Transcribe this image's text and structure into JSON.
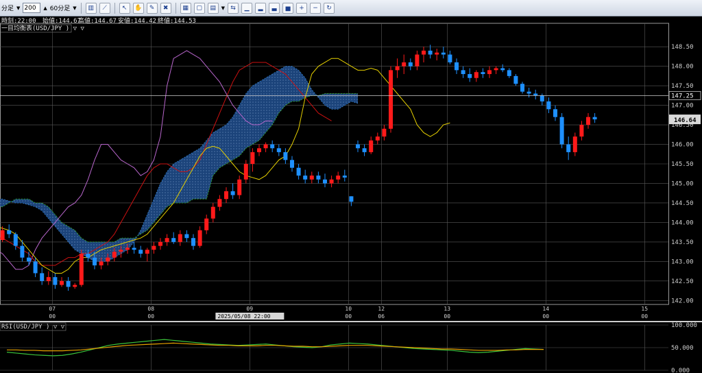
{
  "toolbar": {
    "period_label": "分足",
    "bar_count": "200",
    "timeframe": "60分足",
    "icons": [
      "bar-chart-icon",
      "line-chart-icon",
      "cursor-icon",
      "hand-icon",
      "pencil-icon",
      "trash-icon",
      "tile-icon",
      "window-icon",
      "indicator-icon",
      "compare-icon",
      "chart-a-icon",
      "chart-b-icon",
      "chart-c-icon",
      "chart-d-icon",
      "zoom-in-icon",
      "zoom-out-icon",
      "refresh-icon"
    ]
  },
  "info": {
    "time": "時刻:22:00",
    "open": "始値:144.67",
    "high": "高値:144.67",
    "low": "安値:144.42",
    "close": "終値:144.53"
  },
  "colors": {
    "up": "#ff1a1a",
    "down": "#1e90ff",
    "cloud": "#1e4a88",
    "tenkan": "#e6d000",
    "kijun": "#cc1111",
    "chikou": "#b866cc",
    "span_a": "#2a6fb6",
    "span_b": "#2e9e2e",
    "rsi": "#3bc43b",
    "rsi_ma": "#e8a300"
  },
  "main_panel": {
    "title": "一目均衡表(USD/JPY ) ▽ ▽"
  },
  "rsi_panel": {
    "title": "RSI(USD/JPY ) ▽ ▽"
  },
  "chart_data": [
    {
      "type": "candlestick",
      "title": "一目均衡表(USD/JPY )",
      "y_ticks": [
        142.0,
        142.5,
        143.0,
        143.5,
        144.0,
        144.5,
        145.0,
        145.5,
        146.0,
        146.5,
        147.0,
        147.5,
        148.0,
        148.5
      ],
      "ylim": [
        141.9,
        149.1
      ],
      "date_labels": [
        {
          "label": "07",
          "bar": 9
        },
        {
          "label": "08",
          "bar": 24
        },
        {
          "label": "09",
          "bar": 39
        },
        {
          "label": "10",
          "bar": 54
        },
        {
          "label": "12",
          "bar": 59
        },
        {
          "label": "13",
          "bar": 69
        },
        {
          "label": "14",
          "bar": 84
        },
        {
          "label": "15",
          "bar": 99
        }
      ],
      "hour_labels": [
        {
          "label": "00",
          "bar": 9
        },
        {
          "label": "00",
          "bar": 24
        },
        {
          "label": "00",
          "bar": 54
        },
        {
          "label": "06",
          "bar": 59
        },
        {
          "label": "00",
          "bar": 69
        },
        {
          "label": "00",
          "bar": 84
        },
        {
          "label": "00",
          "bar": 99
        }
      ],
      "cursor_label": "2025/05/08 22:00",
      "price_lines": [
        {
          "label": "147.25",
          "price": 147.25
        }
      ],
      "last_price": {
        "label": "146.64",
        "price": 146.64
      },
      "grid": true,
      "ohlc": [
        [
          143.6,
          143.75,
          143.45,
          143.55
        ],
        [
          143.55,
          143.9,
          143.5,
          143.8
        ],
        [
          143.8,
          143.95,
          143.6,
          143.7
        ],
        [
          143.7,
          143.75,
          143.3,
          143.4
        ],
        [
          143.4,
          143.55,
          143.0,
          143.1
        ],
        [
          143.1,
          143.25,
          142.9,
          143.0
        ],
        [
          143.0,
          143.1,
          142.6,
          142.7
        ],
        [
          142.7,
          142.85,
          142.4,
          142.5
        ],
        [
          142.5,
          142.75,
          142.4,
          142.6
        ],
        [
          142.6,
          142.7,
          142.3,
          142.4
        ],
        [
          142.4,
          142.6,
          142.35,
          142.5
        ],
        [
          142.5,
          142.6,
          142.25,
          142.35
        ],
        [
          142.35,
          142.45,
          142.3,
          142.4
        ],
        [
          142.4,
          143.3,
          142.35,
          143.2
        ],
        [
          143.2,
          143.3,
          143.0,
          143.1
        ],
        [
          143.1,
          143.25,
          142.8,
          142.9
        ],
        [
          142.9,
          143.1,
          142.8,
          143.0
        ],
        [
          143.0,
          143.2,
          142.9,
          143.1
        ],
        [
          143.1,
          143.35,
          143.0,
          143.25
        ],
        [
          143.25,
          143.4,
          143.1,
          143.3
        ],
        [
          143.3,
          143.45,
          143.2,
          143.35
        ],
        [
          143.35,
          143.5,
          143.2,
          143.3
        ],
        [
          143.3,
          143.4,
          143.1,
          143.2
        ],
        [
          143.2,
          143.35,
          143.0,
          143.3
        ],
        [
          143.3,
          143.5,
          143.2,
          143.4
        ],
        [
          143.4,
          143.6,
          143.3,
          143.5
        ],
        [
          143.5,
          143.7,
          143.4,
          143.6
        ],
        [
          143.6,
          143.75,
          143.45,
          143.5
        ],
        [
          143.5,
          143.8,
          143.4,
          143.7
        ],
        [
          143.7,
          143.8,
          143.5,
          143.6
        ],
        [
          143.6,
          143.7,
          143.3,
          143.4
        ],
        [
          143.4,
          143.9,
          143.35,
          143.8
        ],
        [
          143.8,
          144.2,
          143.7,
          144.1
        ],
        [
          144.1,
          144.5,
          144.0,
          144.4
        ],
        [
          144.4,
          144.7,
          144.3,
          144.6
        ],
        [
          144.6,
          144.9,
          144.5,
          144.8
        ],
        [
          144.8,
          145.0,
          144.6,
          144.7
        ],
        [
          144.7,
          145.2,
          144.6,
          145.1
        ],
        [
          145.1,
          145.6,
          145.0,
          145.5
        ],
        [
          145.5,
          145.9,
          145.3,
          145.8
        ],
        [
          145.8,
          146.0,
          145.7,
          145.9
        ],
        [
          145.9,
          146.05,
          145.8,
          146.0
        ],
        [
          146.0,
          146.1,
          145.8,
          145.9
        ],
        [
          145.9,
          146.0,
          145.7,
          145.8
        ],
        [
          145.8,
          145.9,
          145.5,
          145.6
        ],
        [
          145.6,
          145.7,
          145.3,
          145.4
        ],
        [
          145.4,
          145.5,
          145.1,
          145.2
        ],
        [
          145.2,
          145.35,
          145.0,
          145.1
        ],
        [
          145.1,
          145.3,
          145.0,
          145.2
        ],
        [
          145.2,
          145.3,
          145.0,
          145.1
        ],
        [
          145.1,
          145.25,
          144.9,
          145.0
        ],
        [
          145.0,
          145.2,
          144.9,
          145.1
        ],
        [
          145.1,
          145.3,
          145.0,
          145.2
        ],
        [
          145.2,
          145.35,
          145.05,
          145.15
        ],
        [
          144.67,
          144.67,
          144.42,
          144.53
        ],
        [
          146.0,
          146.1,
          145.8,
          145.9
        ],
        [
          145.9,
          146.0,
          145.7,
          145.8
        ],
        [
          145.8,
          146.2,
          145.75,
          146.1
        ],
        [
          146.1,
          146.3,
          146.0,
          146.2
        ],
        [
          146.2,
          146.5,
          146.1,
          146.4
        ],
        [
          146.4,
          148.0,
          146.3,
          147.9
        ],
        [
          147.9,
          148.2,
          147.7,
          148.0
        ],
        [
          148.0,
          148.3,
          147.8,
          148.1
        ],
        [
          148.1,
          148.2,
          147.9,
          148.0
        ],
        [
          148.0,
          148.4,
          147.9,
          148.3
        ],
        [
          148.3,
          148.5,
          148.1,
          148.4
        ],
        [
          148.4,
          148.55,
          148.2,
          148.3
        ],
        [
          148.3,
          148.45,
          148.15,
          148.35
        ],
        [
          148.35,
          148.5,
          148.2,
          148.3
        ],
        [
          148.3,
          148.4,
          148.05,
          148.1
        ],
        [
          148.1,
          148.2,
          147.8,
          147.9
        ],
        [
          147.9,
          148.0,
          147.7,
          147.8
        ],
        [
          147.8,
          147.95,
          147.6,
          147.7
        ],
        [
          147.7,
          147.9,
          147.6,
          147.85
        ],
        [
          147.85,
          147.95,
          147.7,
          147.8
        ],
        [
          147.8,
          148.0,
          147.7,
          147.9
        ],
        [
          147.9,
          148.0,
          147.8,
          147.95
        ],
        [
          147.95,
          148.05,
          147.85,
          147.9
        ],
        [
          147.9,
          147.95,
          147.7,
          147.75
        ],
        [
          147.75,
          147.8,
          147.5,
          147.55
        ],
        [
          147.55,
          147.6,
          147.3,
          147.35
        ],
        [
          147.35,
          147.45,
          147.2,
          147.3
        ],
        [
          147.3,
          147.4,
          147.15,
          147.25
        ],
        [
          147.25,
          147.3,
          147.0,
          147.1
        ],
        [
          147.1,
          147.2,
          146.8,
          146.9
        ],
        [
          146.9,
          147.0,
          146.6,
          146.7
        ],
        [
          146.7,
          146.8,
          145.9,
          146.0
        ],
        [
          146.0,
          146.2,
          145.6,
          145.8
        ],
        [
          145.8,
          146.3,
          145.7,
          146.2
        ],
        [
          146.2,
          146.6,
          146.1,
          146.5
        ],
        [
          146.5,
          146.8,
          146.4,
          146.7
        ],
        [
          146.7,
          146.8,
          146.55,
          146.64
        ]
      ],
      "tenkan": [
        143.9,
        143.85,
        143.8,
        143.7,
        143.5,
        143.3,
        143.1,
        142.9,
        142.8,
        142.7,
        142.7,
        142.8,
        143.0,
        143.1,
        143.1,
        143.2,
        143.3,
        143.35,
        143.4,
        143.45,
        143.5,
        143.55,
        143.6,
        143.7,
        143.9,
        144.1,
        144.3,
        144.5,
        144.8,
        145.1,
        145.4,
        145.7,
        145.9,
        145.95,
        145.9,
        145.7,
        145.5,
        145.3,
        145.2,
        145.15,
        145.1,
        145.2,
        145.4,
        145.6,
        145.7,
        146.0,
        146.4,
        147.2,
        147.8,
        148.0,
        148.1,
        148.2,
        148.2,
        148.1,
        148.0,
        147.9,
        147.9,
        147.95,
        147.9,
        147.7,
        147.5,
        147.3,
        147.1,
        146.9,
        146.5,
        146.3,
        146.2,
        146.3,
        146.5,
        146.55
      ],
      "kijun": [
        143.6,
        143.6,
        143.5,
        143.4,
        143.3,
        143.2,
        143.0,
        142.9,
        142.9,
        142.9,
        143.0,
        143.1,
        143.1,
        143.2,
        143.2,
        143.3,
        143.4,
        143.5,
        143.7,
        144.0,
        144.3,
        144.6,
        144.9,
        145.2,
        145.4,
        145.5,
        145.5,
        145.4,
        145.3,
        145.3,
        145.4,
        145.6,
        146.0,
        146.4,
        146.8,
        147.2,
        147.6,
        147.9,
        148.0,
        148.1,
        148.1,
        148.1,
        148.0,
        147.9,
        147.8,
        147.6,
        147.4,
        147.2,
        147.0,
        146.8,
        146.7,
        146.6
      ],
      "chikou": [
        143.3,
        143.2,
        143.0,
        142.8,
        142.8,
        142.9,
        143.3,
        143.6,
        143.8,
        144.0,
        144.2,
        144.4,
        144.5,
        144.7,
        145.1,
        145.6,
        146.0,
        146.0,
        145.8,
        145.6,
        145.5,
        145.4,
        145.2,
        145.3,
        145.6,
        146.2,
        147.5,
        148.2,
        148.3,
        148.4,
        148.3,
        148.2,
        148.0,
        147.8,
        147.6,
        147.3,
        147.0,
        146.8,
        146.6,
        146.5,
        146.5,
        146.6,
        146.6
      ],
      "span_a": [
        144.6,
        144.6,
        144.55,
        144.5,
        144.5,
        144.45,
        144.4,
        144.3,
        144.1,
        143.9,
        143.7,
        143.5,
        143.3,
        143.2,
        143.1,
        143.0,
        143.0,
        143.0,
        143.1,
        143.2,
        143.3,
        143.5,
        143.8,
        144.2,
        144.6,
        145.0,
        145.3,
        145.5,
        145.6,
        145.7,
        145.8,
        145.9,
        146.1,
        146.3,
        146.4,
        146.5,
        146.7,
        147.0,
        147.3,
        147.5,
        147.6,
        147.7,
        147.8,
        147.9,
        148.0,
        148.0,
        147.9,
        147.7,
        147.4,
        147.2,
        147.0,
        146.9,
        146.9,
        147.0,
        147.1,
        147.05
      ],
      "span_b": [
        144.4,
        144.4,
        144.5,
        144.6,
        144.6,
        144.6,
        144.5,
        144.5,
        144.4,
        144.2,
        144.0,
        143.9,
        143.8,
        143.6,
        143.5,
        143.5,
        143.5,
        143.5,
        143.5,
        143.6,
        143.6,
        143.6,
        143.7,
        143.8,
        144.0,
        144.2,
        144.4,
        144.5,
        144.5,
        144.5,
        144.6,
        144.6,
        144.6,
        145.2,
        145.4,
        145.5,
        145.6,
        145.7,
        145.9,
        146.0,
        146.1,
        146.3,
        146.5,
        146.8,
        147.0,
        147.1,
        147.1,
        147.2,
        147.25,
        147.25,
        147.3,
        147.3,
        147.3,
        147.3,
        147.3,
        147.3
      ]
    },
    {
      "type": "line",
      "title": "RSI(USD/JPY )",
      "y_ticks": [
        0.0,
        50.0,
        100.0
      ],
      "y_tick_labels": [
        "0.000",
        "50.000",
        "100.000"
      ],
      "ylim": [
        0,
        100
      ],
      "series": [
        {
          "values": [
            40,
            38,
            36,
            34,
            33,
            32,
            33,
            36,
            40,
            45,
            50,
            55,
            58,
            60,
            62,
            64,
            66,
            68,
            66,
            64,
            62,
            60,
            58,
            57,
            56,
            55,
            56,
            57,
            58,
            56,
            54,
            52,
            51,
            50,
            52,
            56,
            58,
            60,
            59,
            58,
            56,
            54,
            52,
            50,
            48,
            47,
            46,
            45,
            44,
            42,
            40,
            39,
            40,
            42,
            44,
            46,
            48,
            47,
            46
          ]
        },
        {
          "values": [
            45,
            45,
            44,
            44,
            43,
            43,
            43,
            44,
            45,
            47,
            49,
            51,
            53,
            55,
            56,
            57,
            58,
            59,
            60,
            59,
            58,
            57,
            56,
            55,
            55,
            54,
            54,
            54,
            55,
            55,
            54,
            53,
            53,
            52,
            52,
            53,
            54,
            55,
            55,
            55,
            54,
            53,
            52,
            51,
            50,
            49,
            48,
            47,
            47,
            46,
            45,
            44,
            44,
            44,
            45,
            45,
            46,
            46,
            46
          ]
        }
      ]
    }
  ]
}
